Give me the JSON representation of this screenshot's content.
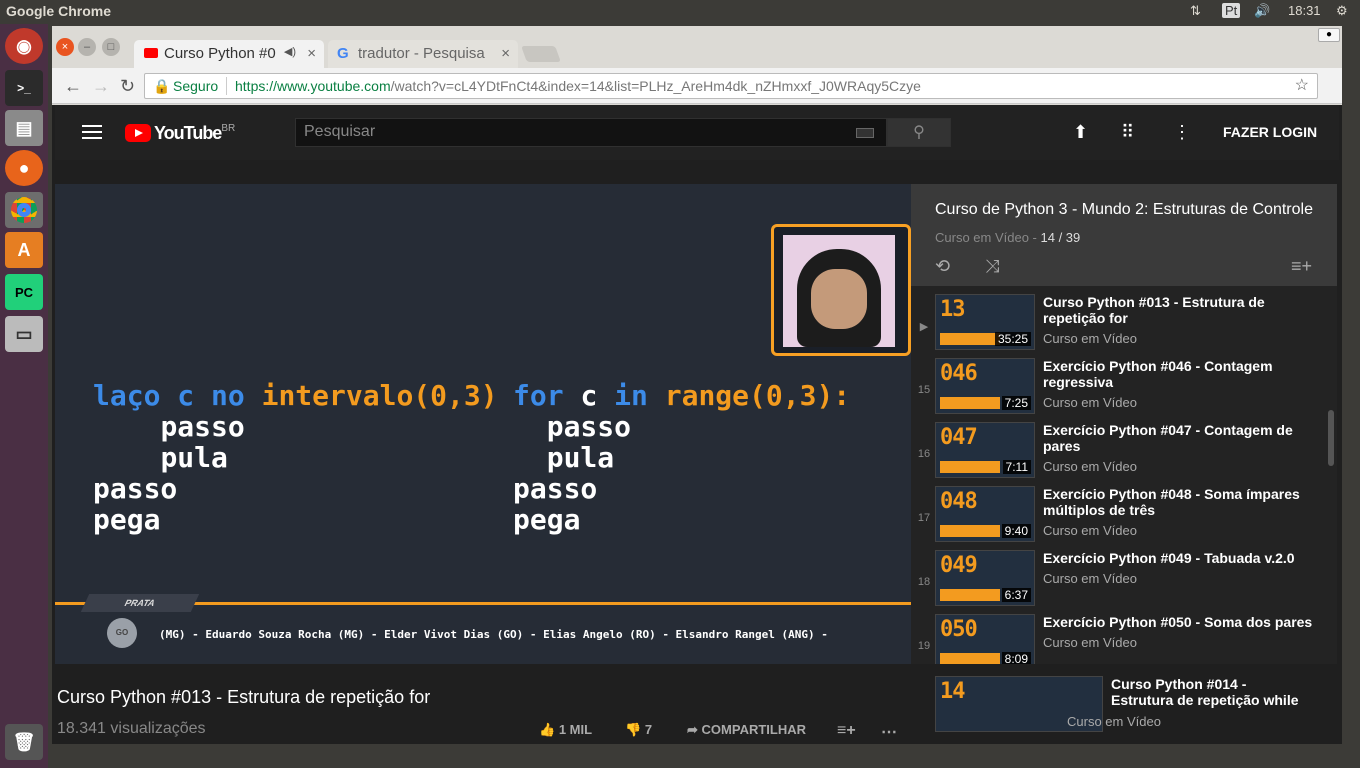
{
  "os": {
    "title": "Google Chrome",
    "lang": "Pt",
    "time": "18:31"
  },
  "tabs": [
    {
      "label": "Curso Python #0"
    },
    {
      "label": "tradutor - Pesquisa"
    }
  ],
  "omnibox": {
    "secure": "Seguro",
    "url_host": "https://www.youtube.com",
    "url_path": "/watch?v=cL4YDtFnCt4&index=14&list=PLHz_AreHm4dk_nZHmxxf_J0WRAqy5Czye"
  },
  "masthead": {
    "logo": "YouTube",
    "region": "BR",
    "search_placeholder": "Pesquisar",
    "login": "FAZER LOGIN"
  },
  "video": {
    "code_left": {
      "l1a": "laço c ",
      "l1b": "no ",
      "l1c": "intervalo(0,3)",
      "l2": "passo",
      "l3": "pula",
      "l4": "passo",
      "l5": "pega"
    },
    "code_right": {
      "l1a": "for ",
      "l1b": "c ",
      "l1c": "in ",
      "l1d": "range(0,3):",
      "l2": "passo",
      "l3": "pula",
      "l4": "passo",
      "l5": "pega"
    },
    "badge": "PRATA",
    "medal": "GO",
    "ticker": "(MG) - Eduardo Souza Rocha (MG) - Elder Vivot Dias (GO) - Elias Angelo (RO) - Elsandro Rangel (ANG) -",
    "title": "Curso Python #013 - Estrutura de repetição for",
    "views": "18.341 visualizações",
    "likes": "1 MIL",
    "dislikes": "7",
    "share": "COMPARTILHAR"
  },
  "playlist": {
    "title": "Curso de Python 3 - Mundo 2: Estruturas de Controle",
    "channel": "Curso em Vídeo",
    "position": "14 / 39",
    "items": [
      {
        "index": "▶",
        "thumb": "13",
        "title": "Curso Python #013 - Estrutura de repetição for",
        "channel": "Curso em Vídeo",
        "duration": "35:25"
      },
      {
        "index": "15",
        "thumb": "046",
        "title": "Exercício Python #046 - Contagem regressiva",
        "channel": "Curso em Vídeo",
        "duration": "7:25"
      },
      {
        "index": "16",
        "thumb": "047",
        "title": "Exercício Python #047 - Contagem de pares",
        "channel": "Curso em Vídeo",
        "duration": "7:11"
      },
      {
        "index": "17",
        "thumb": "048",
        "title": "Exercício Python #048 - Soma ímpares múltiplos de três",
        "channel": "Curso em Vídeo",
        "duration": "9:40"
      },
      {
        "index": "18",
        "thumb": "049",
        "title": "Exercício Python #049 - Tabuada v.2.0",
        "channel": "Curso em Vídeo",
        "duration": "6:37"
      },
      {
        "index": "19",
        "thumb": "050",
        "title": "Exercício Python #050 - Soma dos pares",
        "channel": "Curso em Vídeo",
        "duration": "8:09"
      }
    ]
  },
  "up_next": {
    "thumb": "14",
    "title": "Curso Python #014 - Estrutura de repetição while",
    "channel": "Curso em Vídeo"
  }
}
